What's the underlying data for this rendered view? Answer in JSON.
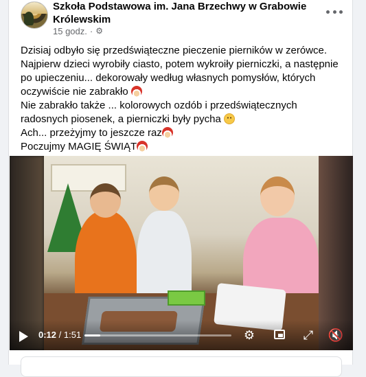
{
  "post": {
    "page_name": "Szkoła Podstawowa im. Jana Brzechwy w Grabowie Królewskim",
    "time": "15 godz.",
    "privacy_icon": "gear-icon",
    "more_icon": "ellipsis-icon"
  },
  "text": {
    "line1": "Dzisiaj odbyło się przedświąteczne pieczenie pierników w zerówce.",
    "line2": "Najpierw dzieci wyrobiły ciasto,  potem wykroiły pierniczki, a następnie",
    "line3": "po upieczeniu... dekorowały według własnych pomysłów, których",
    "line4": "oczywiście  nie zabrakło",
    "line5": "Nie zabrakło także ... kolorowych ozdób i przedświątecznych",
    "line6": "radosnych piosenek, a pierniczki były pycha",
    "line7": "Ach... przeżyjmy to jeszcze raz",
    "line8": "Poczujmy MAGIĘ ŚWIĄT"
  },
  "video": {
    "current_time": "0:12",
    "separator": " / ",
    "total_time": "1:51",
    "progress_fraction": 0.108,
    "play_icon": "play-icon",
    "settings_icon": "settings-icon",
    "pip_icon": "picture-in-picture-icon",
    "fullscreen_icon": "fullscreen-icon",
    "volume_icon": "volume-muted-icon"
  }
}
